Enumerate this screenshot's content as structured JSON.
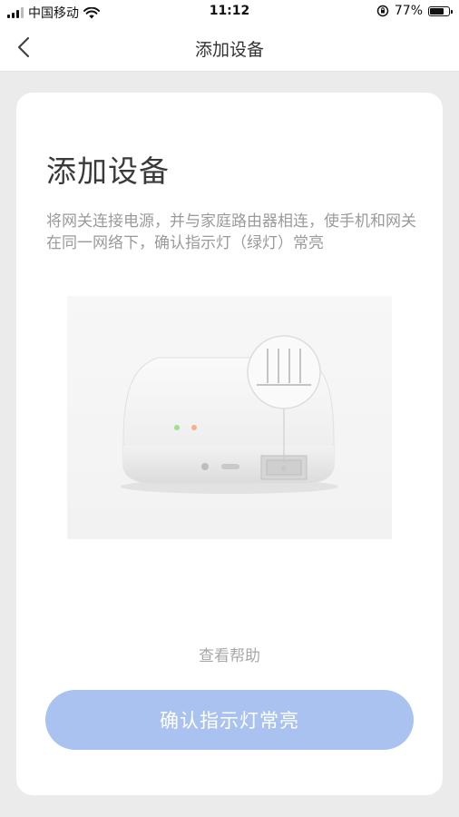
{
  "status_bar": {
    "carrier": "中国移动",
    "time": "11:12",
    "battery_percent_label": "77%",
    "battery_level": 0.77,
    "icons": [
      "signal-icon",
      "wifi-icon",
      "rotation-lock-icon",
      "battery-icon"
    ]
  },
  "nav": {
    "title": "添加设备",
    "back_icon": "chevron-left-icon"
  },
  "card": {
    "title": "添加设备",
    "description": "将网关连接电源，并与家庭路由器相连，使手机和网关在同一网络下，确认指示灯（绿灯）常亮",
    "help_label": "查看帮助",
    "confirm_label": "确认指示灯常亮"
  },
  "colors": {
    "primary_button": "#a9c2ef",
    "indicator_green": "#9fe08a",
    "indicator_orange": "#f5b08a",
    "page_background": "#ebebeb"
  }
}
